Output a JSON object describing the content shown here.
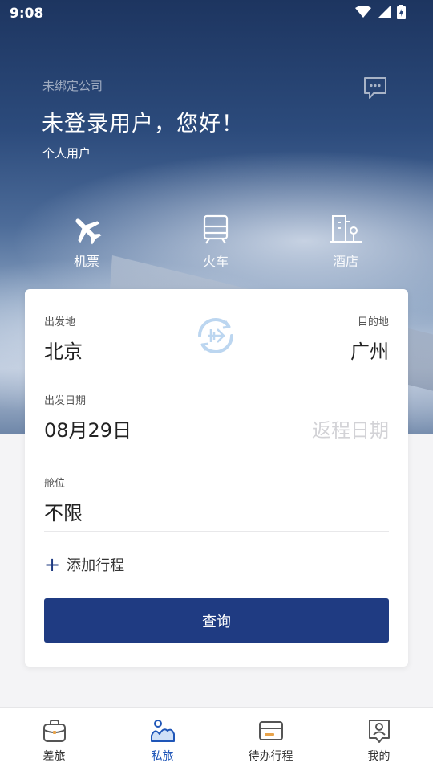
{
  "status_bar": {
    "time": "9:08",
    "icons": [
      "wifi-icon",
      "signal-icon",
      "battery-charging-icon"
    ]
  },
  "header": {
    "company": "未绑定公司",
    "greeting": "未登录用户，您好！",
    "user_type": "个人用户",
    "message_icon": "chat-bubble-icon"
  },
  "categories": [
    {
      "label": "机票",
      "icon": "airplane-icon",
      "active": true
    },
    {
      "label": "火车",
      "icon": "train-icon",
      "active": false
    },
    {
      "label": "酒店",
      "icon": "hotel-icon",
      "active": false
    }
  ],
  "search": {
    "from_label": "出发地",
    "from_value": "北京",
    "to_label": "目的地",
    "to_value": "广州",
    "swap_icon": "swap-route-icon",
    "depart_label": "出发日期",
    "depart_value": "08月29日",
    "return_placeholder": "返程日期",
    "cabin_label": "舱位",
    "cabin_value": "不限",
    "add_trip_label": "添加行程",
    "query_label": "查询"
  },
  "bottom_nav": [
    {
      "label": "差旅",
      "icon": "briefcase-icon",
      "active": false
    },
    {
      "label": "私旅",
      "icon": "mountain-user-icon",
      "active": true
    },
    {
      "label": "待办行程",
      "icon": "card-icon",
      "active": false
    },
    {
      "label": "我的",
      "icon": "profile-icon",
      "active": false
    }
  ],
  "colors": {
    "primary": "#1f3b82",
    "nav_active": "#1f56b8",
    "card_bg": "#ffffff",
    "page_bg": "#f4f4f6"
  }
}
